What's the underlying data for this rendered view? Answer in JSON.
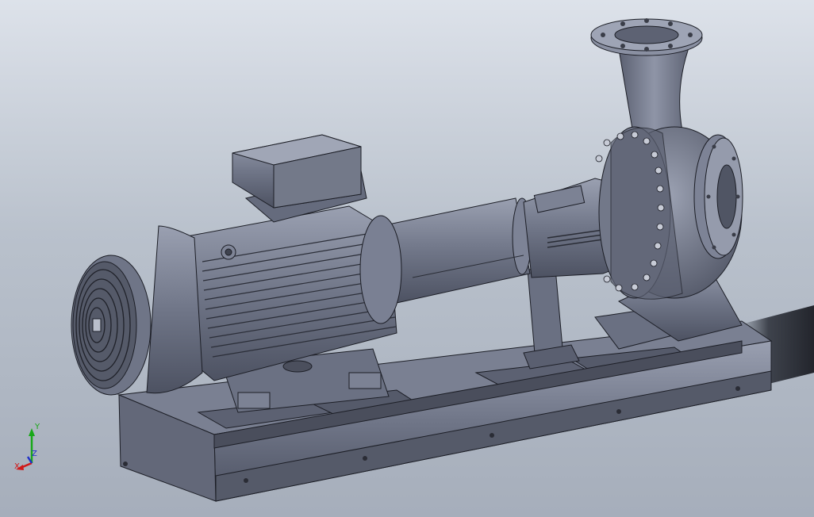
{
  "view": {
    "background_top": "#dde2ea",
    "background_bottom": "#a6aebb",
    "model_color": "#6e7487",
    "edge_color": "#1c1e26"
  },
  "model": {
    "parts": [
      "motor",
      "fan-cover",
      "terminal-box",
      "coupling-guard",
      "bearing-bracket",
      "volute-casing",
      "discharge-flange",
      "suction-flange",
      "baseplate"
    ]
  },
  "triad": {
    "x_label": "X",
    "y_label": "Y",
    "z_label": "Z",
    "x_color": "#d01818",
    "y_color": "#18a818",
    "z_color": "#2030c8"
  }
}
